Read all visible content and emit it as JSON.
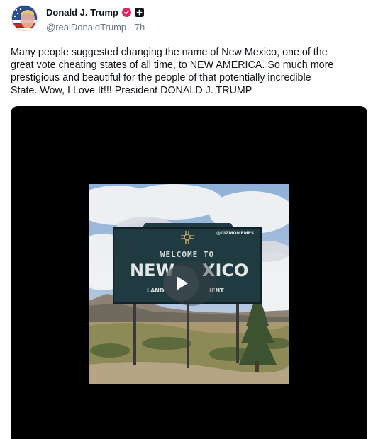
{
  "author": {
    "display_name": "Donald J. Trump",
    "handle": "@realDonaldTrump",
    "separator": "·",
    "time": "7h"
  },
  "post": {
    "text_lines": [
      "Many people suggested changing the name of New Mexico, one of the",
      "great vote cheating states of all time, to NEW AMERICA. So much more",
      "prestigious and beautiful for the people of that potentially incredible",
      "State. Wow, I Love It!!! President DONALD J. TRUMP"
    ]
  },
  "media": {
    "type": "video",
    "watermark": "@GIZMOMEMES",
    "sign": {
      "line1": "WELCOME TO",
      "line2_left": "NEW",
      "line2_right": "XICO",
      "line3_left": "LAND",
      "line3_right": "IENT"
    }
  },
  "icons": {
    "verified": "verified-check-icon",
    "plus": "plus-badge-icon",
    "play": "play-icon",
    "zia": "zia-sun-symbol-icon"
  },
  "colors": {
    "verified": "#e0245e",
    "meta": "#687684",
    "media_bg": "#000000",
    "sign": "#1f3a40"
  }
}
